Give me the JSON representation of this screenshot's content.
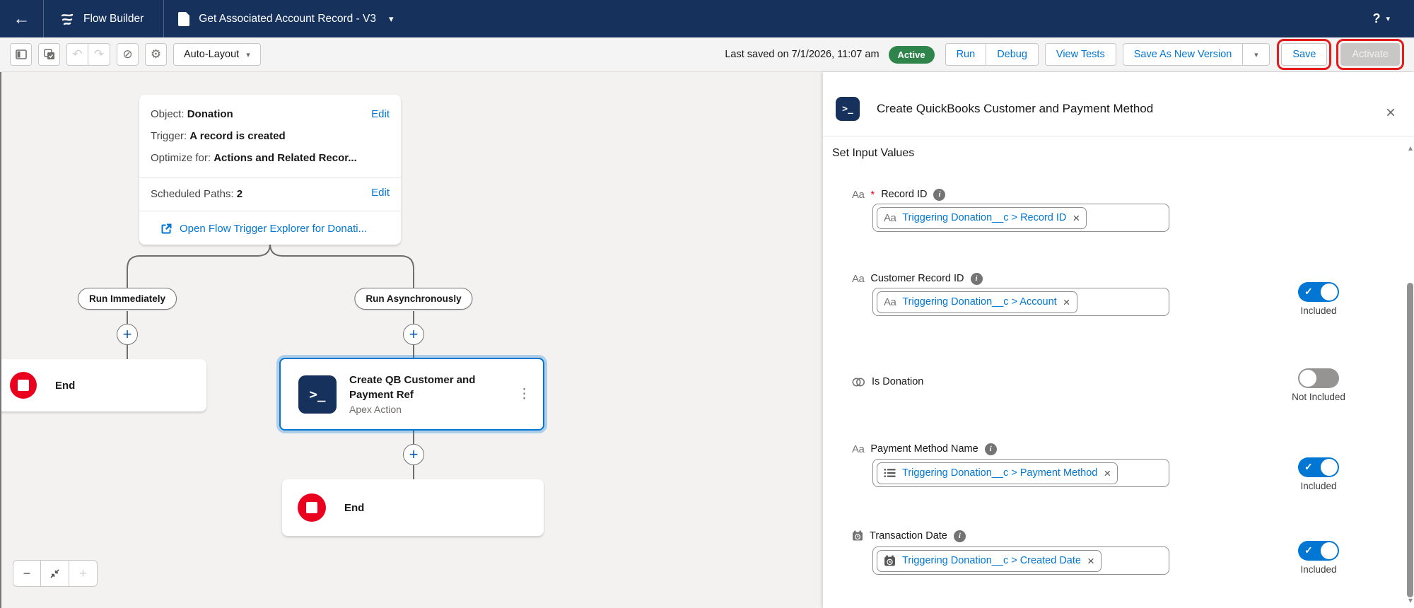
{
  "icons": {
    "back": "←",
    "caret_down": "▾",
    "help": "?",
    "undo": "↶",
    "redo": "↷",
    "disable": "⊘",
    "gear": "⚙",
    "plus": "+",
    "minus": "−",
    "kebab": "⋮",
    "close": "×",
    "remove": "×",
    "check": "✓",
    "text_type": "Aa",
    "info": "i",
    "terminal": ">_",
    "scroll_up": "▴",
    "scroll_down": "▾"
  },
  "header": {
    "app_name": "Flow Builder",
    "flow_name": "Get Associated Account Record - V3"
  },
  "toolbar": {
    "layout_label": "Auto-Layout",
    "last_saved": "Last saved on 7/1/2026, 11:07 am",
    "status": "Active",
    "run": "Run",
    "debug": "Debug",
    "view_tests": "View Tests",
    "save_as_new_version": "Save As New Version",
    "save": "Save",
    "activate": "Activate"
  },
  "canvas": {
    "start_node": {
      "rows": [
        {
          "label": "Object:",
          "value": "Donation"
        },
        {
          "label": "Trigger:",
          "value": "A record is created"
        },
        {
          "label": "Optimize for:",
          "value": "Actions and Related Recor..."
        }
      ],
      "edit": "Edit",
      "scheduled_paths_label": "Scheduled Paths:",
      "scheduled_paths_value": "2",
      "trigger_explorer": "Open Flow Trigger Explorer for Donati..."
    },
    "branch_left": "Run Immediately",
    "branch_right": "Run Asynchronously",
    "end_label": "End",
    "apex_node": {
      "title": "Create QB Customer and Payment Ref",
      "subtitle": "Apex Action"
    },
    "end_label_2": "End"
  },
  "panel": {
    "title": "Create QuickBooks Customer and Payment Method",
    "section_title": "Set Input Values",
    "fields": [
      {
        "label": "Record ID",
        "required": "*",
        "type": "text",
        "pill": "Triggering Donation__c > Record ID",
        "toggle_label": ""
      },
      {
        "label": "Customer Record ID",
        "type": "text",
        "pill": "Triggering Donation__c > Account",
        "toggle_label": "Included"
      },
      {
        "label": "Is Donation",
        "type": "boolean",
        "toggle_label": "Not Included"
      },
      {
        "label": "Payment Method Name",
        "type": "picklist",
        "pill": "Triggering Donation__c > Payment Method",
        "toggle_label": "Included"
      },
      {
        "label": "Transaction Date",
        "type": "date",
        "pill": "Triggering Donation__c > Created Date",
        "toggle_label": "Included"
      }
    ]
  },
  "colors": {
    "header_bg": "#16325c",
    "accent_blue": "#0176d3",
    "active_green": "#2e844a",
    "end_red": "#ea001e",
    "annotation_red": "#e41c1c",
    "canvas_bg": "#f3f2f1"
  }
}
